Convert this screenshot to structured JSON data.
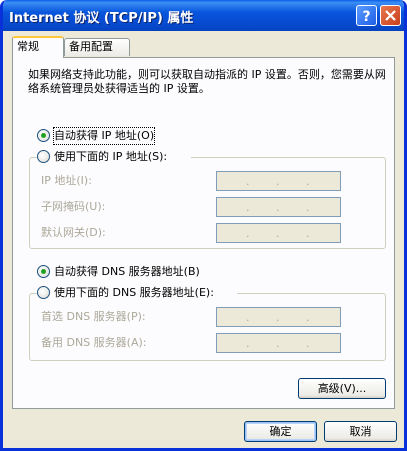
{
  "window": {
    "title": "Internet 协议 (TCP/IP) 属性"
  },
  "tabs": [
    {
      "label": "常规",
      "active": true
    },
    {
      "label": "备用配置",
      "active": false
    }
  ],
  "description": "如果网络支持此功能，则可以获取自动指派的 IP 设置。否则，您需要从网络系统管理员处获得适当的 IP 设置。",
  "ip_section": {
    "auto_label": "自动获得 IP 地址(O)",
    "manual_label": "使用下面的 IP 地址(S):",
    "selected": "auto",
    "fields": [
      {
        "label": "IP 地址(I):",
        "value": ""
      },
      {
        "label": "子网掩码(U):",
        "value": ""
      },
      {
        "label": "默认网关(D):",
        "value": ""
      }
    ]
  },
  "dns_section": {
    "auto_label": "自动获得 DNS 服务器地址(B)",
    "manual_label": "使用下面的 DNS 服务器地址(E):",
    "selected": "auto",
    "fields": [
      {
        "label": "首选 DNS 服务器(P):",
        "value": ""
      },
      {
        "label": "备用 DNS 服务器(A):",
        "value": ""
      }
    ]
  },
  "buttons": {
    "advanced": "高级(V)...",
    "ok": "确定",
    "cancel": "取消"
  },
  "icons": {
    "help": "help-icon",
    "close": "close-icon"
  },
  "colors": {
    "titlebar": "#0855dd",
    "selected_radio": "#21a121",
    "disabled_text": "#aca899"
  }
}
